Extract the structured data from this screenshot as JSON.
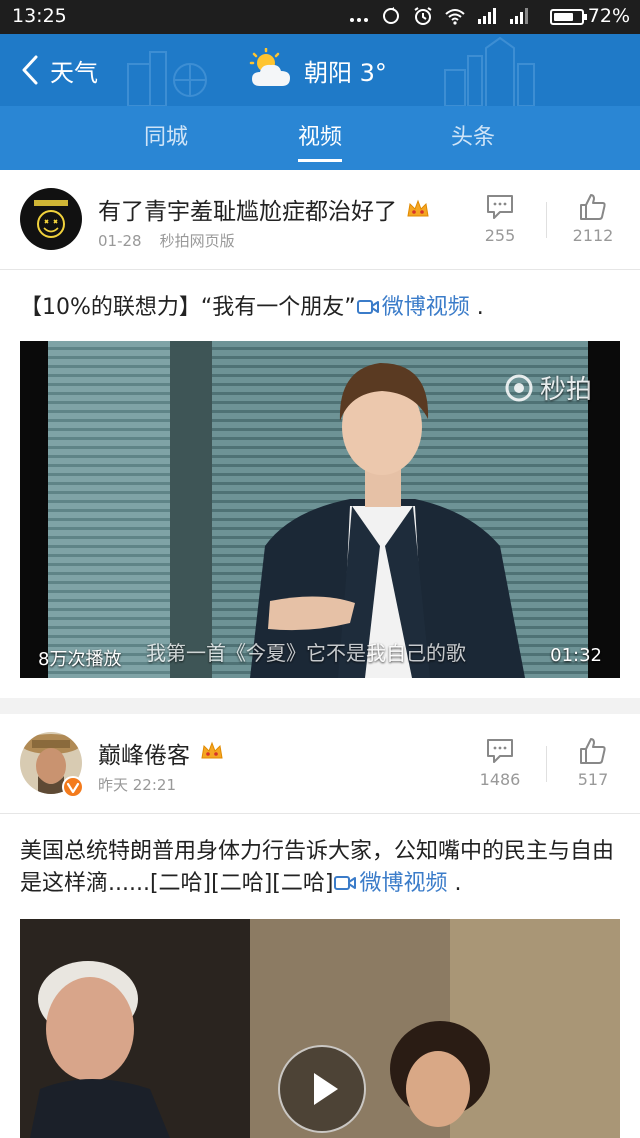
{
  "status_bar": {
    "time": "13:25",
    "battery_text": "72%",
    "battery_level": 0.72,
    "icons": [
      "more-dots-icon",
      "sync-icon",
      "alarm-icon",
      "wifi-icon",
      "signal-icon",
      "signal-icon",
      "battery-icon"
    ]
  },
  "header": {
    "back_label": "天气",
    "weather_icon": "partly-cloudy-icon",
    "weather_text": "朝阳 3°",
    "background_color": "#1f7ac8"
  },
  "tabs": [
    {
      "label": "同城",
      "active": false
    },
    {
      "label": "视频",
      "active": true
    },
    {
      "label": "头条",
      "active": false
    }
  ],
  "posts": [
    {
      "user_name": "有了青宇羞耻尴尬症都治好了",
      "date": "01-28",
      "source": "秒拍网页版",
      "comment_count": "255",
      "like_count": "2112",
      "text_before_link": "【10%的联想力】“我有一个朋友”",
      "link_text": "微博视频",
      "text_after_link": " .",
      "video": {
        "watermark": "秒拍",
        "play_count": "8万次播放",
        "subtitle": "我第一首《今夏》它不是我自己的歌",
        "duration": "01:32"
      }
    },
    {
      "user_name": "巅峰倦客",
      "date": "昨天 22:21",
      "source": "",
      "comment_count": "1486",
      "like_count": "517",
      "text_before_link": "美国总统特朗普用身体力行告诉大家，公知嘴中的民主与自由是这样滴......[二哈][二哈][二哈]",
      "link_text": "微博视频",
      "text_after_link": " ."
    }
  ]
}
